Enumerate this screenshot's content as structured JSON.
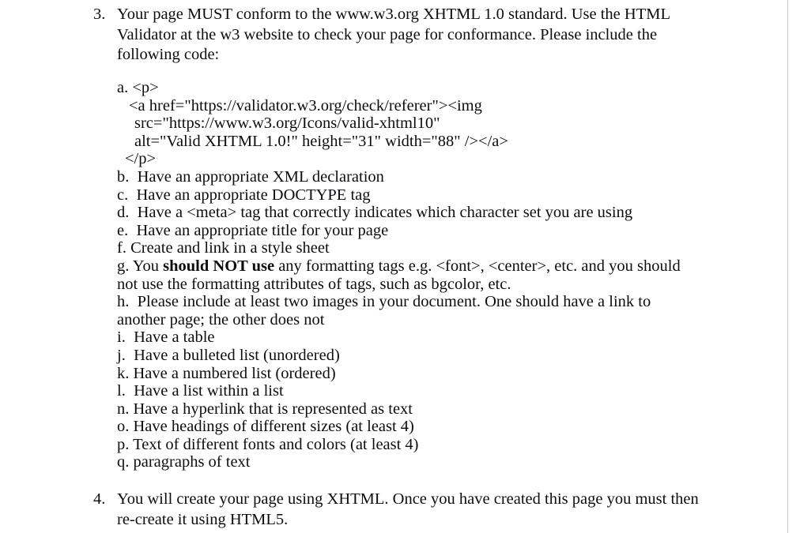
{
  "document": {
    "items": [
      {
        "marker": "3.",
        "text": "Your page MUST conform to the www.w3.org XHTML 1.0 standard. Use the HTML Validator at the w3 website to check your page for conformance. Please include the following code:"
      },
      {
        "marker": "4.",
        "text": "You will create your page using XHTML. Once you have created this page you must then re-create it using HTML5."
      }
    ],
    "sub_list": {
      "code_item": {
        "marker": "a.",
        "lines": [
          "<p>",
          "<a href=\"https://validator.w3.org/check/referer\"><img",
          "src=\"https://www.w3.org/Icons/valid-xhtml10\"",
          "alt=\"Valid XHTML 1.0!\" height=\"31\" width=\"88\" /></a>",
          "</p>"
        ]
      },
      "items": [
        {
          "marker": "b.",
          "text": "Have an appropriate XML declaration"
        },
        {
          "marker": "c.",
          "text": "Have an appropriate DOCTYPE tag"
        },
        {
          "marker": "d.",
          "text": "Have a <meta> tag that correctly indicates which character set you are using"
        },
        {
          "marker": "e.",
          "text": "Have an appropriate title for your page"
        },
        {
          "marker": "f.",
          "text": "Create and link in a style sheet"
        },
        {
          "marker": "g.",
          "text_before": "You ",
          "bold": "should NOT use",
          "text_after": " any formatting tags e.g. <font>, <center>, etc. and you should not use the formatting attributes of tags, such as bgcolor, etc."
        },
        {
          "marker": "h.",
          "text": "Please include at least two images in your document. One should have a link to another page; the other does not"
        },
        {
          "marker": "i.",
          "text": "Have a table"
        },
        {
          "marker": "j.",
          "text": "Have a bulleted list (unordered)"
        },
        {
          "marker": "k.",
          "text": "Have a numbered list (ordered)"
        },
        {
          "marker": "l.",
          "text": "Have a list within a list"
        },
        {
          "marker": "n.",
          "text": "Have a hyperlink that is represented as text"
        },
        {
          "marker": "o.",
          "text": "Have headings of different sizes (at least 4)"
        },
        {
          "marker": "p.",
          "text": "Text of different fonts and colors (at least 4)"
        },
        {
          "marker": "q.",
          "text": "paragraphs of text"
        }
      ]
    }
  }
}
